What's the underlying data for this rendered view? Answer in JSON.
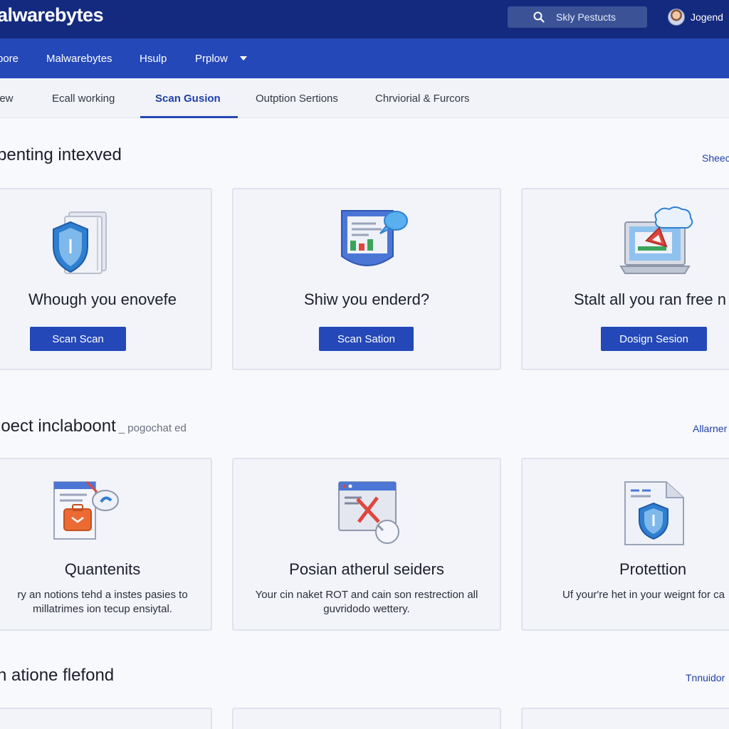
{
  "header": {
    "brand": "alwarebytes",
    "search_text": "Skly Pestucts",
    "user_name": "Jogend"
  },
  "nav": {
    "items": [
      "bore",
      "Malwarebytes",
      "Hsulp",
      "Prplow"
    ]
  },
  "tabs": {
    "items": [
      "iew",
      "Ecall working",
      "Scan Gusion",
      "Outption Sertions",
      "Chrviorial & Furcors"
    ],
    "active_index": 2
  },
  "section1": {
    "title": "penting intexved",
    "link": "Sheec",
    "cards": [
      {
        "icon": "shield-files-icon",
        "title": "Whough you enovefe",
        "button": "Scan Scan"
      },
      {
        "icon": "document-chat-icon",
        "title": "Shiw you enderd?",
        "button": "Scan Sation"
      },
      {
        "icon": "laptop-warning-cloud-icon",
        "title": "Stalt all you ran free n",
        "button": "Dosign Sesion"
      }
    ]
  },
  "section2": {
    "title": "loect inclaboont",
    "subtitle": "_ pogochat ed",
    "link": "Allarner",
    "cards": [
      {
        "icon": "briefcase-document-icon",
        "title": "Quantenits",
        "desc_line1": "ry an notions tehd a instes pasies to",
        "desc_line2": "millatrimes ion tecup ensiytal."
      },
      {
        "icon": "browser-tools-icon",
        "title": "Posian atherul seiders",
        "desc_line1": "Your cin naket ROT and cain son restrection all",
        "desc_line2": "guvridodo wettery."
      },
      {
        "icon": "shield-document-icon",
        "title": "Protettion",
        "desc_line1": "Uf your're het in your weignt for ca",
        "desc_line2": ""
      }
    ]
  },
  "section3": {
    "title": "n atione flefond",
    "link": "Tnnuidor"
  },
  "colors": {
    "topbar": "#142a7f",
    "navbar": "#2448b8",
    "accent": "#2448b8",
    "card_bg": "#f2f4fa",
    "link": "#1f3fa8"
  }
}
